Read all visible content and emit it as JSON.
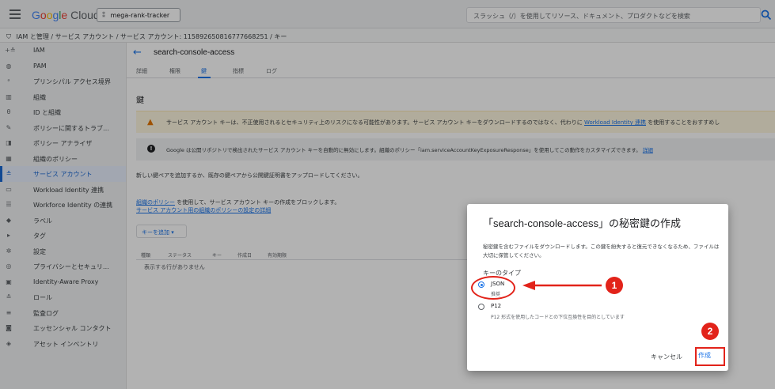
{
  "topbar": {
    "logo_parts": [
      "G",
      "o",
      "o",
      "g",
      "l",
      "e",
      " Cloud"
    ],
    "project": "mega-rank-tracker",
    "search_placeholder": "スラッシュ（/）を使用してリソース、ドキュメント、プロダクトなどを検索"
  },
  "breadcrumb": {
    "text": "IAM と管理 / サービス アカウント / サービス アカウント: 115892650816777668251 / キー"
  },
  "sidebar": {
    "items": [
      {
        "icon": "+≗",
        "label": "IAM",
        "active": false
      },
      {
        "icon": "◍",
        "label": "PAM",
        "active": false
      },
      {
        "icon": "ᵃ",
        "label": "プリンシパル アクセス境界",
        "active": false
      },
      {
        "icon": "▥",
        "label": "組織",
        "active": false
      },
      {
        "icon": "θ",
        "label": "ID と組織",
        "active": false
      },
      {
        "icon": "✎",
        "label": "ポリシーに関するトラブ…",
        "active": false
      },
      {
        "icon": "◨",
        "label": "ポリシー アナライザ",
        "active": false
      },
      {
        "icon": "▦",
        "label": "組織のポリシー",
        "active": false
      },
      {
        "icon": "≗",
        "label": "サービス アカウント",
        "active": true
      },
      {
        "icon": "▭",
        "label": "Workload Identity 連携",
        "active": false
      },
      {
        "icon": "☰",
        "label": "Workforce Identity の連携",
        "active": false
      },
      {
        "icon": "◆",
        "label": "ラベル",
        "active": false
      },
      {
        "icon": "▸",
        "label": "タグ",
        "active": false
      },
      {
        "icon": "✲",
        "label": "設定",
        "active": false
      },
      {
        "icon": "◎",
        "label": "プライバシーとセキュリ…",
        "active": false
      },
      {
        "icon": "▣",
        "label": "Identity-Aware Proxy",
        "active": false
      },
      {
        "icon": "≗",
        "label": "ロール",
        "active": false
      },
      {
        "icon": "≡",
        "label": "監査ログ",
        "active": false
      },
      {
        "icon": "◙",
        "label": "エッセンシャル コンタクト",
        "active": false
      },
      {
        "icon": "◈",
        "label": "アセット インベントリ",
        "active": false
      }
    ]
  },
  "main": {
    "title": "search-console-access",
    "tabs": [
      {
        "label": "詳細",
        "active": false
      },
      {
        "label": "権限",
        "active": false
      },
      {
        "label": "鍵",
        "active": true
      },
      {
        "label": "指標",
        "active": false
      },
      {
        "label": "ログ",
        "active": false
      }
    ],
    "section_title": "鍵",
    "warning_text": "サービス アカウント キーは、不正使用されるとセキュリティ上のリスクになる可能性があります。サービス アカウント キーをダウンロードするのではなく、代わりに ",
    "warning_link": "Workload Identity 連携",
    "warning_tail": " を使用することをおすすめし",
    "info_text": "Google は公開リポジトリで検出されたサービス アカウント キーを自動的に無効にします。組織のポリシー「iam.serviceAccountKeyExposureResponse」を使用してこの動作をカスタマイズできます。",
    "info_link": "詳細",
    "desc": "新しい鍵ペアを追加するか、既存の鍵ペアから公開鍵証明書をアップロードしてください。",
    "policy_line1_link": "組織のポリシー",
    "policy_line1_text": " を使用して、サービス アカウント キーの作成をブロックします。",
    "policy_line2_link": "サービス アカウント用の組織のポリシーの設定の詳細",
    "add_key": "キーを追加 ▾",
    "table_headers": [
      "種類",
      "ステータス",
      "キー",
      "作成日",
      "有効期限"
    ],
    "table_empty": "表示する行がありません"
  },
  "dialog": {
    "title": "「search-console-access」の秘密鍵の作成",
    "desc": "秘密鍵を含むファイルをダウンロードします。この鍵を紛失すると復元できなくなるため、ファイルは大切に保管してください。",
    "key_type_label": "キーのタイプ",
    "options": [
      {
        "label": "JSON",
        "sub": "推奨",
        "checked": true
      },
      {
        "label": "P12",
        "sub": "P12 形式を使用したコードとの下位互換性を目的としています",
        "checked": false
      }
    ],
    "cancel": "キャンセル",
    "create": "作成"
  },
  "annotations": {
    "badge1": "1",
    "badge2": "2",
    "color": "#e2231a"
  }
}
